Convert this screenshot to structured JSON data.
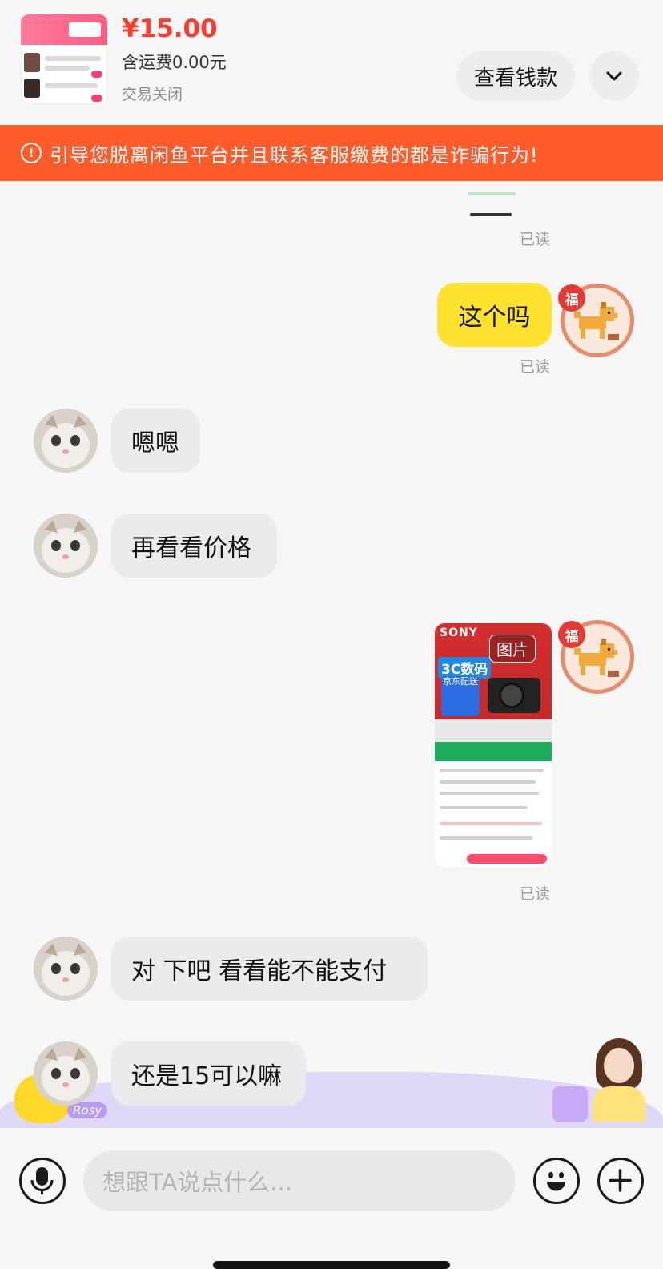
{
  "order": {
    "price": "¥15.00",
    "shipping": "含运费0.00元",
    "status": "交易关闭",
    "view_button": "查看钱款"
  },
  "warning": {
    "text": "引导您脱离闲鱼平台并且联系客服缴费的都是诈骗行为!"
  },
  "messages": [
    {
      "side": "me",
      "type": "read",
      "text": "已读"
    },
    {
      "side": "me",
      "type": "text",
      "text": "这个吗",
      "read": "已读"
    },
    {
      "side": "them",
      "type": "text",
      "text": "嗯嗯"
    },
    {
      "side": "them",
      "type": "text",
      "text": "再看看价格"
    },
    {
      "side": "me",
      "type": "image",
      "label": "图片",
      "read": "已读"
    },
    {
      "side": "them",
      "type": "text",
      "text": "对 下吧 看看能不能支付"
    },
    {
      "side": "them",
      "type": "text",
      "text": "还是15可以嘛"
    }
  ],
  "avatar": {
    "badge": "福"
  },
  "image_card": {
    "brand": "SONY",
    "tag": "3C数码",
    "delivery": "京东配送"
  },
  "banner": {
    "tag": "Rosy"
  },
  "input": {
    "placeholder": "想跟TA说点什么..."
  },
  "icons": [
    "chevron-down-icon",
    "warning-icon",
    "microphone-icon",
    "emoji-icon",
    "plus-icon"
  ]
}
